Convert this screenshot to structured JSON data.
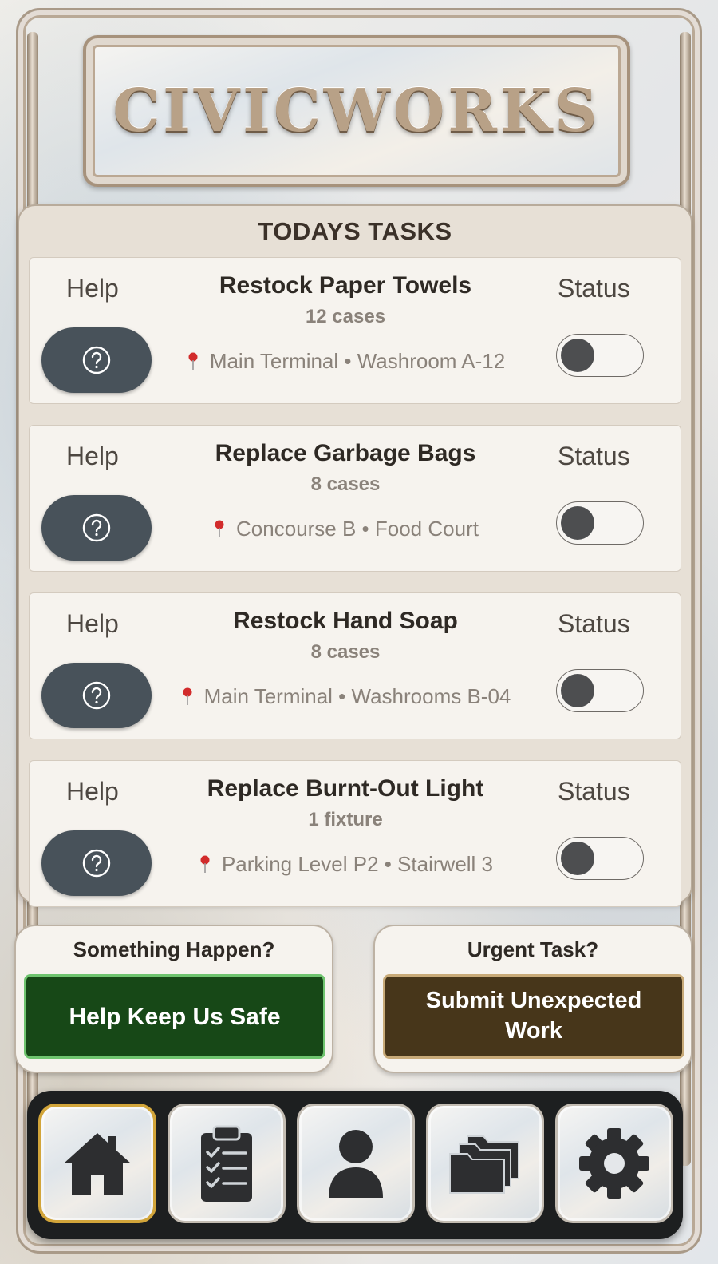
{
  "app": {
    "title": "CIVICWORKS"
  },
  "tasks": {
    "heading": "TODAYS TASKS",
    "items": [
      {
        "help_label": "Help",
        "status_label": "Status",
        "title": "Restock Paper Towels",
        "quantity": "12 cases",
        "location": "Main Terminal • Washroom A-12",
        "status_on": false
      },
      {
        "help_label": "Help",
        "status_label": "Status",
        "title": "Replace Garbage Bags",
        "quantity": "8 cases",
        "location": "Concourse B • Food Court",
        "status_on": false
      },
      {
        "help_label": "Help",
        "status_label": "Status",
        "title": "Restock Hand Soap",
        "quantity": "8 cases",
        "location": "Main Terminal • Washrooms B-04",
        "status_on": false
      },
      {
        "help_label": "Help",
        "status_label": "Status",
        "title": "Replace Burnt-Out Light",
        "quantity": "1 fixture",
        "location": "Parking Level P2 • Stairwell 3",
        "status_on": false
      }
    ]
  },
  "actions": {
    "safety": {
      "title": "Something Happen?",
      "button_label": "Help Keep Us Safe",
      "color": "#174817"
    },
    "urgent": {
      "title": "Urgent Task?",
      "button_label": "Submit Unexpected Work",
      "color": "#47361a"
    }
  },
  "nav": {
    "active": "home",
    "items": [
      {
        "id": "home",
        "icon": "home-icon"
      },
      {
        "id": "tasks",
        "icon": "clipboard-checklist-icon"
      },
      {
        "id": "profile",
        "icon": "person-icon"
      },
      {
        "id": "files",
        "icon": "folders-icon"
      },
      {
        "id": "settings",
        "icon": "gear-icon"
      }
    ]
  },
  "colors": {
    "accent_gold": "#d2a53a",
    "help_button": "#48525a",
    "pin": "#d22b2b"
  }
}
